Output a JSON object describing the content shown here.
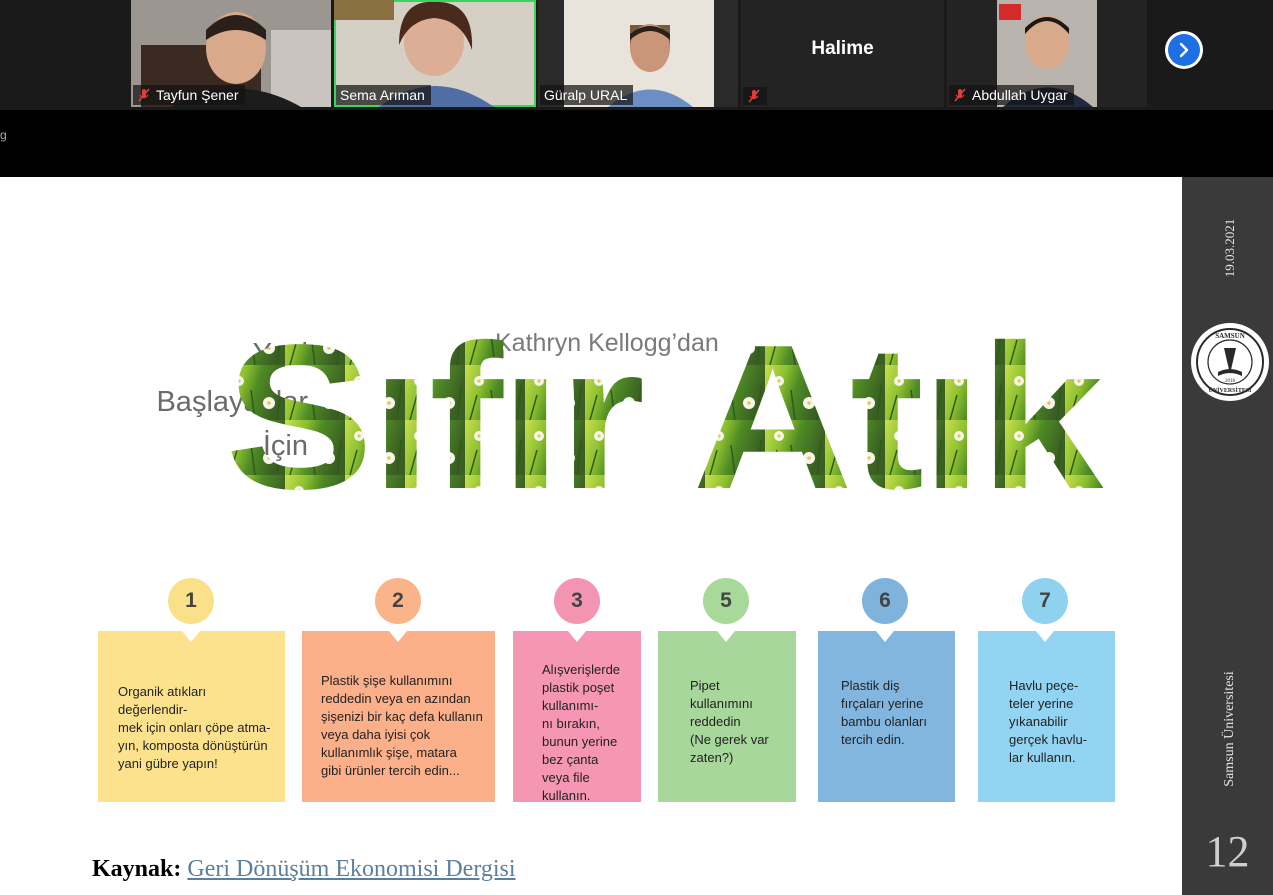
{
  "participants": [
    {
      "name": "Tayfun Şener",
      "muted": true
    },
    {
      "name": "Sema Arıman",
      "muted": false
    },
    {
      "name": "Güralp URAL",
      "muted": false
    },
    {
      "name": "Halime",
      "muted": true
    },
    {
      "name": "Abdullah Uygar",
      "muted": true
    }
  ],
  "edge_glyph": "g",
  "slide": {
    "subtitle_lines": [
      "Yeni",
      "Başlayanlar",
      "İçin"
    ],
    "author": "Kathryn Kellogg’dan",
    "title": "Sıfır Atık",
    "steps": [
      {
        "number": "1",
        "text": "Organik atıkları değerlendir-\nmek için onları çöpe atma-\nyın, komposta dönüştürün\nyani gübre yapın!",
        "circle_color": "#fbe08a",
        "box_color": "#fde28d"
      },
      {
        "number": "2",
        "text": "Plastik şişe kullanımını\nreddedin veya en azından\nşişenizi bir kaç defa kullanın\nveya daha iyisi çok\nkullanımlık şişe, matara\ngibi ürünler tercih edin...",
        "circle_color": "#f9b48a",
        "box_color": "#fbb08a"
      },
      {
        "number": "3",
        "text": "Alışverişlerde\nplastik poşet\nkullanımı-\nnı bırakın,\nbunun yerine\nbez çanta\nveya file\nkullanın.",
        "circle_color": "#f394b2",
        "box_color": "#f596b4"
      },
      {
        "number": "5",
        "text": "Pipet\nkullanımını\nreddedin\n(Ne gerek var\nzaten?)",
        "circle_color": "#a8d89a",
        "box_color": "#a8d79c"
      },
      {
        "number": "6",
        "text": "Plastik diş\nfırçaları yerine\nbambu olanları\ntercih edin.",
        "circle_color": "#7fb3dc",
        "box_color": "#82b6de"
      },
      {
        "number": "7",
        "text": "Havlu peçe-\nteler yerine\nyıkanabilir\ngerçek havlu-\nlar kullanın.",
        "circle_color": "#8fd2f0",
        "box_color": "#92d4f1"
      }
    ],
    "source_label": "Kaynak:",
    "source_link": "Geri Dönüşüm Ekonomisi Dergisi"
  },
  "sidebar": {
    "date": "19.03.2021",
    "university": "Samsun Üniversitesi",
    "seal_text_top": "SAMSUN",
    "seal_text_bottom": "ÜNİVERSİTESİ",
    "seal_year": "2018",
    "page_number": "12"
  },
  "colors": {
    "grass_light": "#b9d94a",
    "grass_dark": "#3d6b1f",
    "speaking_outline": "#3bd45a",
    "next_button": "#1d6fe3"
  }
}
